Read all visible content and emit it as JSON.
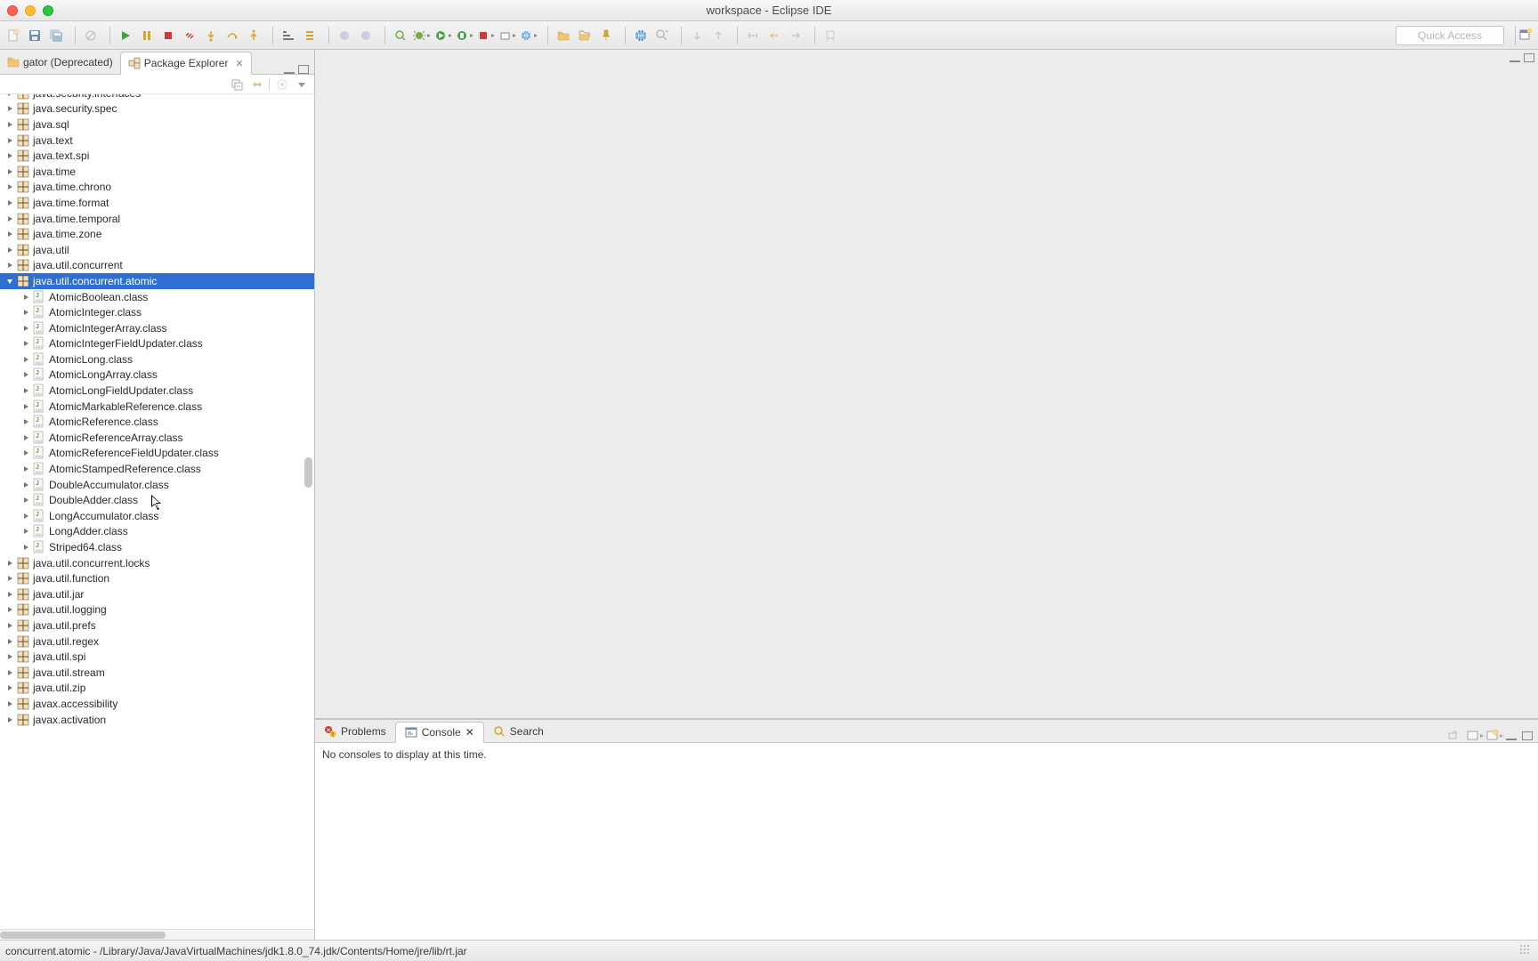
{
  "window": {
    "title": "workspace - Eclipse IDE"
  },
  "toolbar": {
    "quick_access": "Quick Access"
  },
  "left": {
    "tabs": {
      "navigator": "gator (Deprecated)",
      "package_explorer": "Package Explorer"
    }
  },
  "tree": {
    "packages_before": [
      "java.security.interfaces",
      "java.security.spec",
      "java.sql",
      "java.text",
      "java.text.spi",
      "java.time",
      "java.time.chrono",
      "java.time.format",
      "java.time.temporal",
      "java.time.zone",
      "java.util",
      "java.util.concurrent"
    ],
    "selected_package": "java.util.concurrent.atomic",
    "classes": [
      "AtomicBoolean.class",
      "AtomicInteger.class",
      "AtomicIntegerArray.class",
      "AtomicIntegerFieldUpdater.class",
      "AtomicLong.class",
      "AtomicLongArray.class",
      "AtomicLongFieldUpdater.class",
      "AtomicMarkableReference.class",
      "AtomicReference.class",
      "AtomicReferenceArray.class",
      "AtomicReferenceFieldUpdater.class",
      "AtomicStampedReference.class",
      "DoubleAccumulator.class",
      "DoubleAdder.class",
      "LongAccumulator.class",
      "LongAdder.class",
      "Striped64.class"
    ],
    "packages_after": [
      "java.util.concurrent.locks",
      "java.util.function",
      "java.util.jar",
      "java.util.logging",
      "java.util.prefs",
      "java.util.regex",
      "java.util.spi",
      "java.util.stream",
      "java.util.zip",
      "javax.accessibility",
      "javax.activation"
    ]
  },
  "console": {
    "tabs": {
      "problems": "Problems",
      "console": "Console",
      "search": "Search"
    },
    "empty_message": "No consoles to display at this time."
  },
  "status": {
    "path": "concurrent.atomic - /Library/Java/JavaVirtualMachines/jdk1.8.0_74.jdk/Contents/Home/jre/lib/rt.jar"
  }
}
